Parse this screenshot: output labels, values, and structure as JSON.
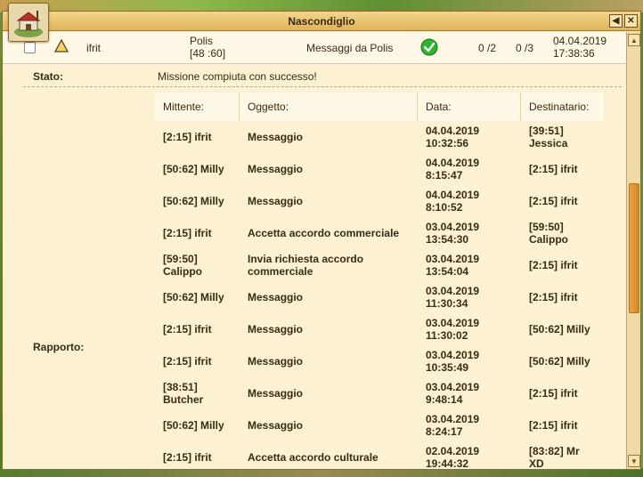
{
  "window": {
    "title": "Nascondiglio",
    "back_icon": "arrow-left-icon",
    "close_icon": "close-icon"
  },
  "message": {
    "from": "ifrit",
    "polis_name": "Polis",
    "polis_coords": "[48 :60]",
    "subject": "Messaggi da Polis",
    "count1": "0 /2",
    "count2": "0 /3",
    "date": "04.04.2019",
    "time": "17:38:36"
  },
  "detail": {
    "stato_label": "Stato:",
    "stato_value": "Missione compiuta con successo!",
    "rapporto_label": "Rapporto:"
  },
  "report": {
    "headers": [
      "Mittente:",
      "Oggetto:",
      "Data:",
      "Destinatario:"
    ],
    "rows": [
      {
        "sender": "[2:15] ifrit",
        "subject": "Messaggio",
        "date": "04.04.2019\n10:32:56",
        "recipient": "[39:51]\nJessica"
      },
      {
        "sender": "[50:62] Milly",
        "subject": "Messaggio",
        "date": "04.04.2019\n8:15:47",
        "recipient": "[2:15] ifrit"
      },
      {
        "sender": "[50:62] Milly",
        "subject": "Messaggio",
        "date": "04.04.2019\n8:10:52",
        "recipient": "[2:15] ifrit"
      },
      {
        "sender": "[2:15] ifrit",
        "subject": "Accetta accordo commerciale",
        "date": "03.04.2019\n13:54:30",
        "recipient": "[59:50]\nCalippo"
      },
      {
        "sender": "[59:50]\nCalippo",
        "subject": "Invia richiesta accordo\ncommerciale",
        "date": "03.04.2019\n13:54:04",
        "recipient": "[2:15] ifrit"
      },
      {
        "sender": "[50:62] Milly",
        "subject": "Messaggio",
        "date": "03.04.2019\n11:30:34",
        "recipient": "[2:15] ifrit"
      },
      {
        "sender": "[2:15] ifrit",
        "subject": "Messaggio",
        "date": "03.04.2019\n11:30:02",
        "recipient": "[50:62] Milly"
      },
      {
        "sender": "[2:15] ifrit",
        "subject": "Messaggio",
        "date": "03.04.2019\n10:35:49",
        "recipient": "[50:62] Milly"
      },
      {
        "sender": "[38:51]\nButcher",
        "subject": "Messaggio",
        "date": "03.04.2019\n9:48:14",
        "recipient": "[2:15] ifrit"
      },
      {
        "sender": "[50:62] Milly",
        "subject": "Messaggio",
        "date": "03.04.2019\n8:24:17",
        "recipient": "[2:15] ifrit"
      },
      {
        "sender": "[2:15] ifrit",
        "subject": "Accetta accordo culturale",
        "date": "02.04.2019\n19:44:32",
        "recipient": "[83:82] Mr\nXD"
      }
    ]
  },
  "colors": {
    "panel": "#fdf1d3",
    "titlebar": "#deb35a",
    "accent": "#e8a540",
    "success": "#2db52d"
  }
}
